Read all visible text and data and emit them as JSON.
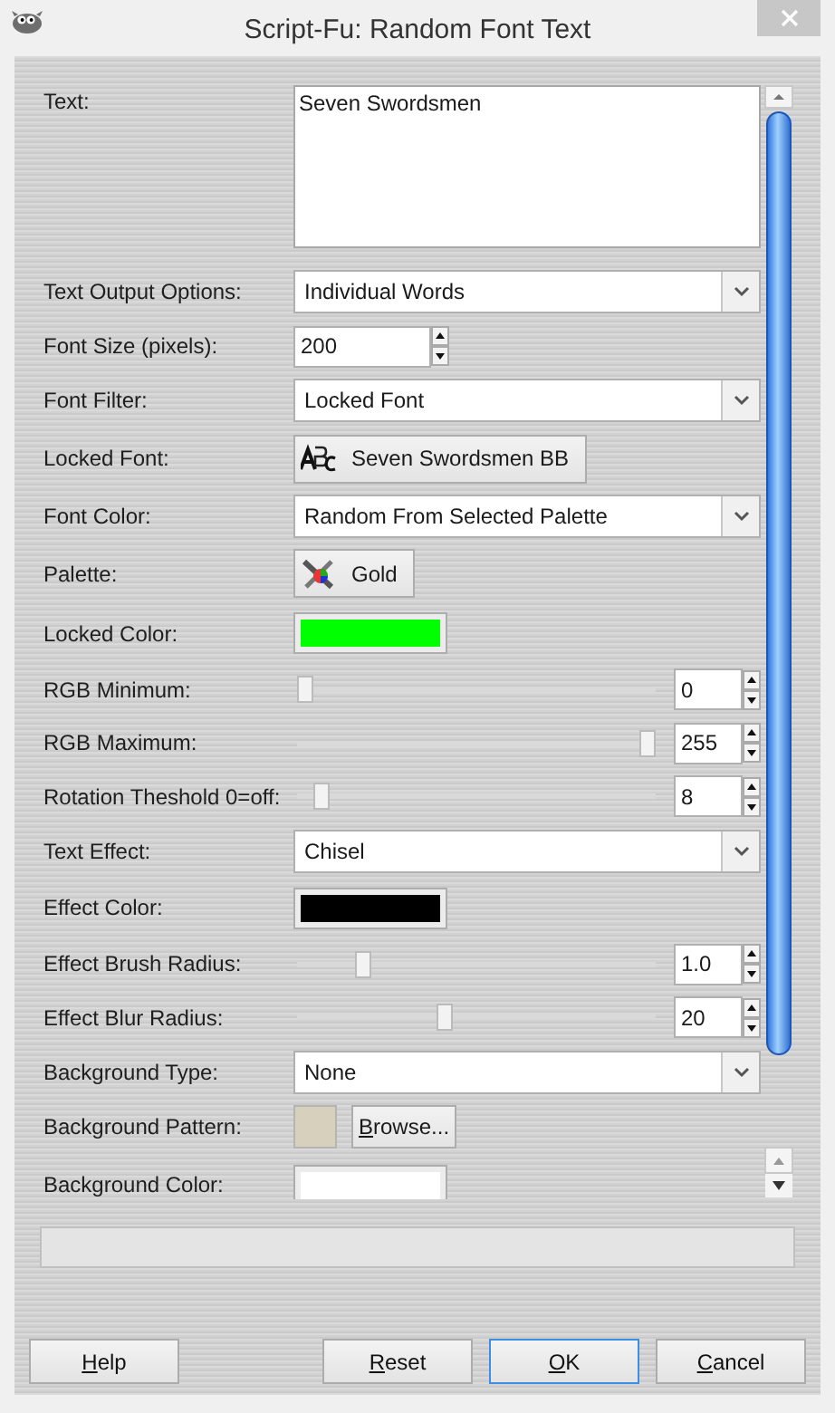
{
  "window": {
    "title": "Script-Fu: Random Font Text"
  },
  "params": [
    {
      "kind": "textarea",
      "label": "Text:",
      "value": "Seven Swordsmen"
    },
    {
      "kind": "combo",
      "label": "Text Output Options:",
      "value": "Individual Words"
    },
    {
      "kind": "spin",
      "label": "Font Size (pixels):",
      "value": "200"
    },
    {
      "kind": "combo",
      "label": "Font Filter:",
      "value": "Locked Font"
    },
    {
      "kind": "font",
      "label": "Locked Font:",
      "value": "Seven Swordsmen BB"
    },
    {
      "kind": "combo",
      "label": "Font Color:",
      "value": "Random From Selected Palette"
    },
    {
      "kind": "palette",
      "label": "Palette:",
      "value": "Gold"
    },
    {
      "kind": "color",
      "label": "Locked Color:",
      "color": "#00ff00"
    },
    {
      "kind": "slider",
      "label": "RGB Minimum:",
      "level": 0,
      "value": "0"
    },
    {
      "kind": "slider",
      "label": "RGB Maximum:",
      "level": 1,
      "value": "255"
    },
    {
      "kind": "slider",
      "label": "Rotation Theshold 0=off:",
      "level": 0.05,
      "value": "8"
    },
    {
      "kind": "combo",
      "label": "Text Effect:",
      "value": "Chisel"
    },
    {
      "kind": "color",
      "label": "Effect Color:",
      "color": "#000000"
    },
    {
      "kind": "slider",
      "label": "Effect Brush Radius:",
      "level": 0.17,
      "value": "1.0"
    },
    {
      "kind": "slider",
      "label": "Effect Blur Radius:",
      "level": 0.41,
      "value": "20"
    },
    {
      "kind": "combo",
      "label": "Background Type:",
      "value": "None"
    },
    {
      "kind": "pattern",
      "label": "Background Pattern:",
      "button": "Browse...",
      "access_key": true
    },
    {
      "kind": "color",
      "label": "Background Color:",
      "color": "#ffffff"
    }
  ],
  "buttons": [
    {
      "label": "Help",
      "access_key": true,
      "focused": false
    },
    {
      "label": "Reset",
      "access_key": true,
      "focused": false
    },
    {
      "label": "OK",
      "access_key": true,
      "focused": true
    },
    {
      "label": "Cancel",
      "access_key": true,
      "focused": false
    }
  ]
}
